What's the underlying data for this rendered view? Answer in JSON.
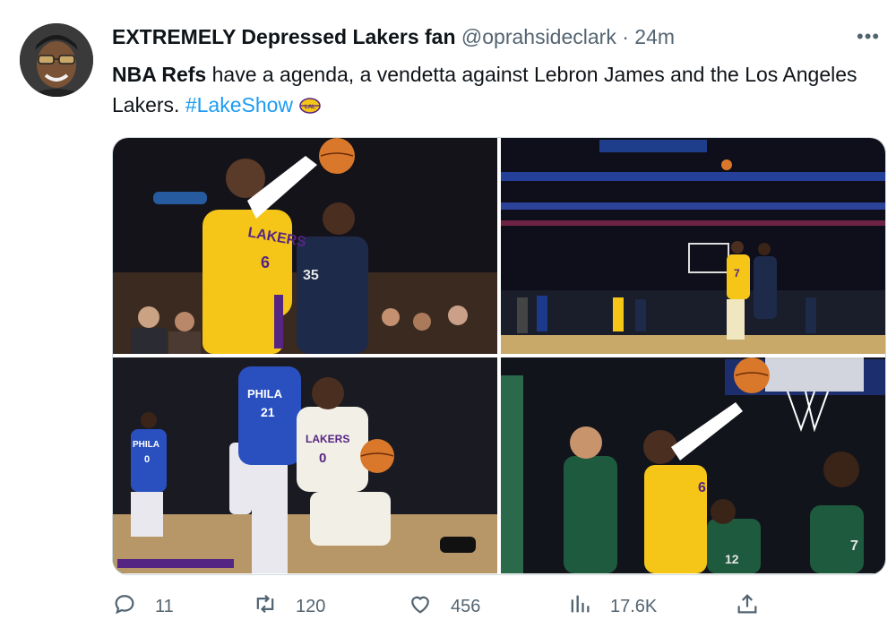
{
  "author": {
    "display_name": "EXTREMELY Depressed Lakers fan",
    "handle": "@oprahsideclark",
    "separator": "·",
    "time": "24m"
  },
  "more_label": "•••",
  "tweet": {
    "bold_lead": "NBA Refs",
    "body": " have a agenda, a vendetta against Lebron James and the Los Angeles Lakers. ",
    "hashtag": "#LakeShow",
    "hashtag_icon": "lakers-emoji"
  },
  "media": {
    "photos": [
      {
        "jersey_labels": [
          "LAKERS",
          "6",
          "35"
        ]
      },
      {
        "jersey_labels": [
          "7"
        ]
      },
      {
        "jersey_labels": [
          "PHILA",
          "21",
          "LAKERS",
          "0",
          "PHILA",
          "0"
        ]
      },
      {
        "jersey_labels": [
          "6",
          "12",
          "7"
        ]
      }
    ]
  },
  "actions": {
    "reply_count": "11",
    "retweet_count": "120",
    "like_count": "456",
    "views_count": "17.6K"
  },
  "colors": {
    "accent": "#1d9bf0",
    "muted": "#536471",
    "text": "#0f1419",
    "lakers_gold": "#f5c518",
    "lakers_purple": "#552583"
  }
}
